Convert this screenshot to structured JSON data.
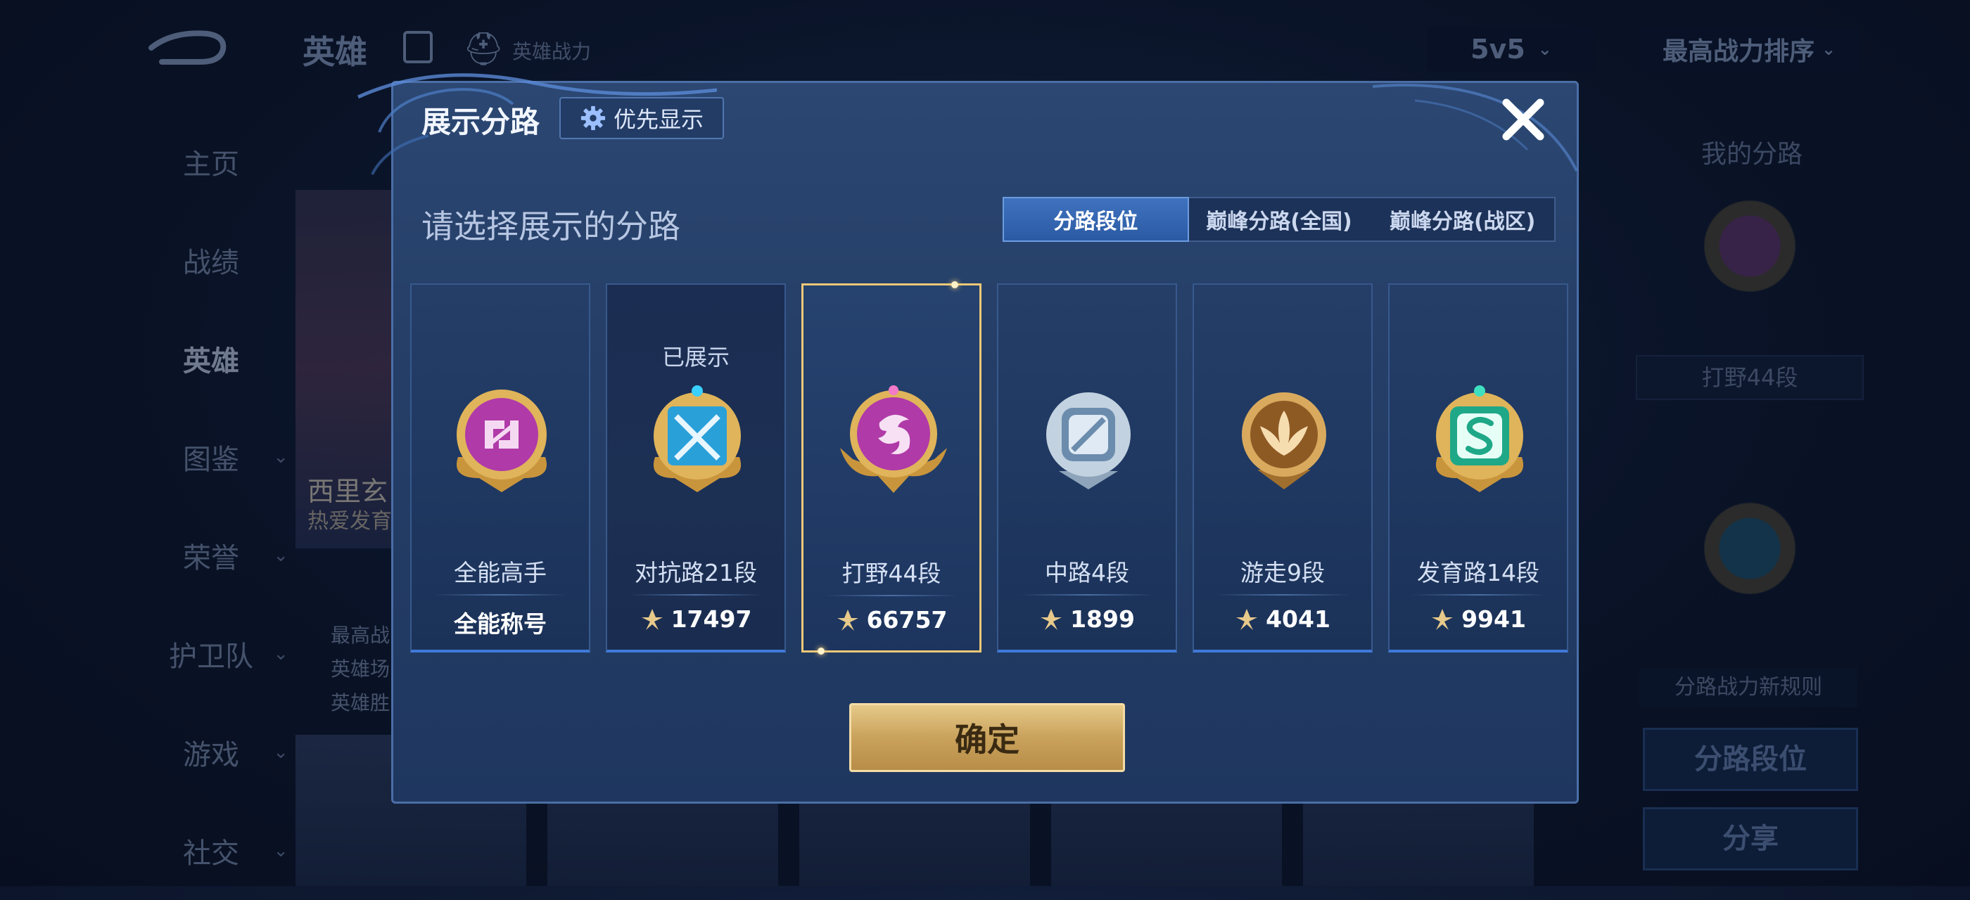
{
  "background": {
    "top_title": "英雄",
    "power_label": "英雄战力",
    "mode_select": "5v5",
    "sort_select": "最高战力排序",
    "nav": [
      {
        "label": "主页",
        "has_chevron": false
      },
      {
        "label": "战绩",
        "has_chevron": false
      },
      {
        "label": "英雄",
        "has_chevron": false,
        "active": true
      },
      {
        "label": "图鉴",
        "has_chevron": true
      },
      {
        "label": "荣誉",
        "has_chevron": true
      },
      {
        "label": "护卫队",
        "has_chevron": true
      },
      {
        "label": "游戏",
        "has_chevron": true
      },
      {
        "label": "社交",
        "has_chevron": true
      }
    ],
    "hero_name": "西里玄",
    "hero_sub": "热爱发育",
    "hero_info": [
      "最高战",
      "英雄场",
      "英雄胜"
    ],
    "right_panel": {
      "title": "我的分路",
      "rank_label": "打野44段",
      "rule_label": "分路战力新规则",
      "lane_rank_button": "分路段位",
      "share_button": "分享"
    }
  },
  "dialog": {
    "title": "展示分路",
    "priority_button": "优先显示",
    "subtitle": "请选择展示的分路",
    "tabs": [
      {
        "label": "分路段位",
        "active": true
      },
      {
        "label": "巅峰分路(全国)",
        "active": false
      },
      {
        "label": "巅峰分路(战区)",
        "active": false
      }
    ],
    "cards": [
      {
        "name": "全能高手",
        "value": "全能称号",
        "has_icon": false,
        "shown_tag": "",
        "badge_color": "#b03aa8",
        "selected": false
      },
      {
        "name": "对抗路21段",
        "value": "17497",
        "has_icon": true,
        "shown_tag": "已展示",
        "badge_color": "#2aa0d8",
        "selected": false
      },
      {
        "name": "打野44段",
        "value": "66757",
        "has_icon": true,
        "shown_tag": "",
        "badge_color": "#b03aa8",
        "selected": true
      },
      {
        "name": "中路4段",
        "value": "1899",
        "has_icon": true,
        "shown_tag": "",
        "badge_color": "#9fb4c8",
        "selected": false
      },
      {
        "name": "游走9段",
        "value": "4041",
        "has_icon": true,
        "shown_tag": "",
        "badge_color": "#c08a3a",
        "selected": false
      },
      {
        "name": "发育路14段",
        "value": "9941",
        "has_icon": true,
        "shown_tag": "",
        "badge_color": "#2ac8a0",
        "selected": false
      }
    ],
    "confirm_button": "确定"
  }
}
